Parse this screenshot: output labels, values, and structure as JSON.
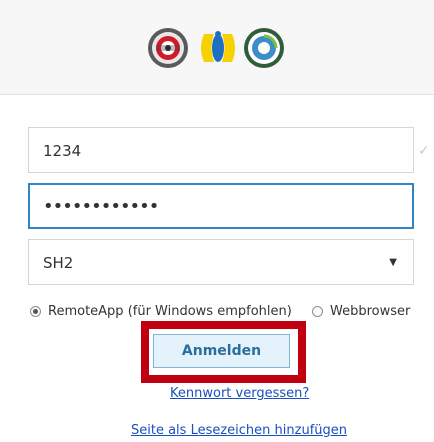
{
  "form": {
    "username_value": "1234",
    "password_value": "••••••••••••",
    "server_value": "SH2"
  },
  "mode": {
    "remoteapp_label": "RemoteApp (für Windows empfohlen)",
    "webbrowser_label": "Webbrowser",
    "selected": "RemoteApp"
  },
  "actions": {
    "login_label": "Anmelden",
    "forgot_label": "Kennwort vergessen?",
    "bookmark_label": "Seite als Lesezeichen hinzufügen"
  },
  "icons": {
    "checkmark": "checkmark-icon",
    "dropdown": "chevron-down-icon",
    "logo1": "association-seal-logo",
    "logo2": "yellow-blue-figures-logo",
    "logo3": "green-ring-logo"
  },
  "colors": {
    "highlight": "#c00010",
    "focus_border": "#2e87c4",
    "link": "#1a4fbd"
  }
}
